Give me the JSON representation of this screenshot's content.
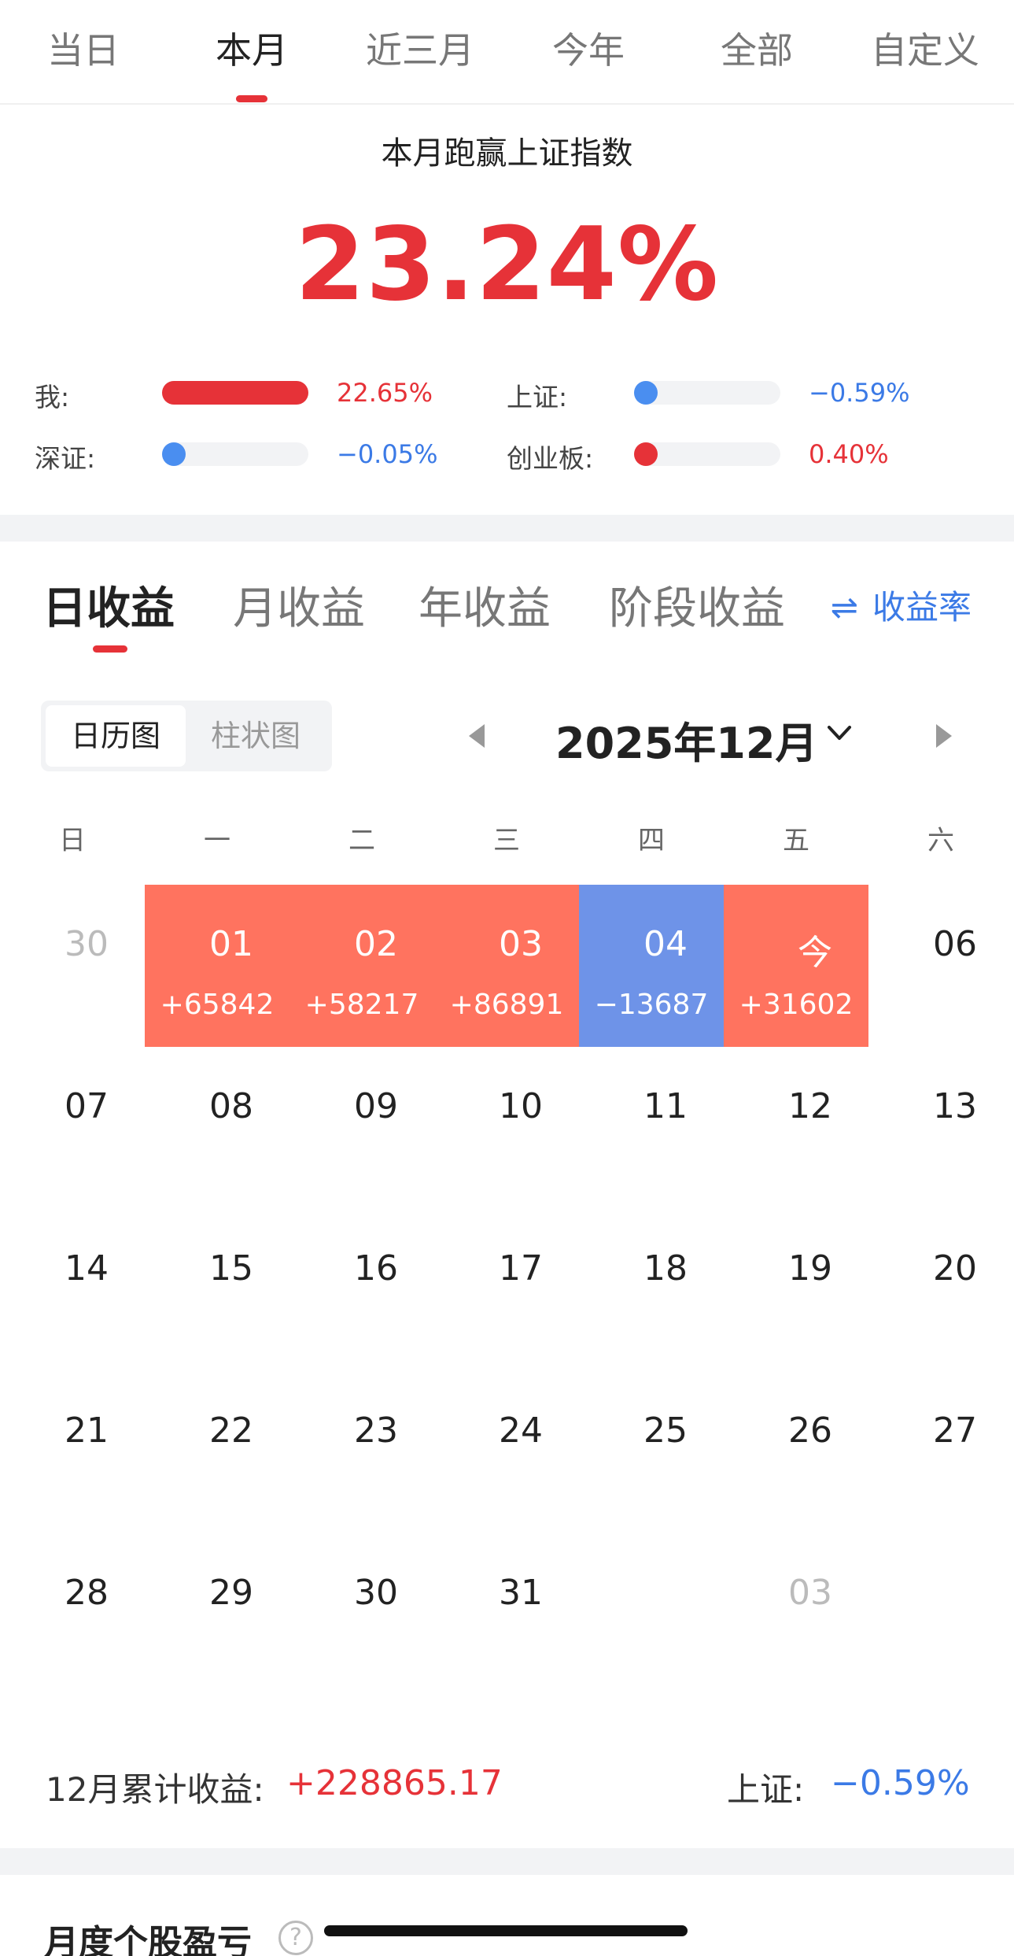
{
  "period_tabs": [
    {
      "label": "当日",
      "active": false
    },
    {
      "label": "本月",
      "active": true
    },
    {
      "label": "近三月",
      "active": false
    },
    {
      "label": "今年",
      "active": false
    },
    {
      "label": "全部",
      "active": false
    },
    {
      "label": "自定义",
      "active": false
    }
  ],
  "summary": {
    "title": "本月跑赢上证指数",
    "value": "23.24%",
    "comparisons": [
      {
        "label": "我:",
        "value": "22.65%",
        "fill": 1.0,
        "color": "red"
      },
      {
        "label": "上证:",
        "value": "−0.59%",
        "fill": 0.0,
        "color": "blue"
      },
      {
        "label": "深证:",
        "value": "−0.05%",
        "fill": 0.0,
        "color": "blue"
      },
      {
        "label": "创业板:",
        "value": "0.40%",
        "fill": 0.0,
        "color": "red"
      }
    ]
  },
  "income_tabs": [
    {
      "label": "日收益",
      "active": true
    },
    {
      "label": "月收益",
      "active": false
    },
    {
      "label": "年收益",
      "active": false
    },
    {
      "label": "阶段收益",
      "active": false
    }
  ],
  "rate_toggle": {
    "icon": "⇌",
    "label": "收益率"
  },
  "view_toggle": {
    "calendar": "日历图",
    "bar": "柱状图"
  },
  "month_picker": {
    "label": "2025年12月"
  },
  "weekdays": [
    "日",
    "一",
    "二",
    "三",
    "四",
    "五",
    "六"
  ],
  "calendar_weeks": [
    [
      {
        "day": "30",
        "muted": true
      },
      {
        "day": "01",
        "pnl": "+65842",
        "state": "gain"
      },
      {
        "day": "02",
        "pnl": "+58217",
        "state": "gain"
      },
      {
        "day": "03",
        "pnl": "+86891",
        "state": "gain"
      },
      {
        "day": "04",
        "pnl": "−13687",
        "state": "loss"
      },
      {
        "day": "今",
        "pnl": "+31602",
        "state": "gain"
      },
      {
        "day": "06"
      }
    ],
    [
      {
        "day": "07"
      },
      {
        "day": "08"
      },
      {
        "day": "09"
      },
      {
        "day": "10"
      },
      {
        "day": "11"
      },
      {
        "day": "12"
      },
      {
        "day": "13"
      }
    ],
    [
      {
        "day": "14"
      },
      {
        "day": "15"
      },
      {
        "day": "16"
      },
      {
        "day": "17"
      },
      {
        "day": "18"
      },
      {
        "day": "19"
      },
      {
        "day": "20"
      }
    ],
    [
      {
        "day": "21"
      },
      {
        "day": "22"
      },
      {
        "day": "23"
      },
      {
        "day": "24"
      },
      {
        "day": "25"
      },
      {
        "day": "26"
      },
      {
        "day": "27"
      }
    ],
    [
      {
        "day": "28"
      },
      {
        "day": "29"
      },
      {
        "day": "30"
      },
      {
        "day": "31"
      },
      {
        "day": ""
      },
      {
        "day": "03",
        "muted": true
      },
      {
        "day": ""
      }
    ]
  ],
  "totals": {
    "label": "12月累计收益:",
    "value": "+228865.17",
    "sh_label": "上证:",
    "sh_value": "−0.59%"
  },
  "section": {
    "title": "月度个股盈亏",
    "help": "?"
  },
  "colors": {
    "red": "#e63238",
    "blue": "#3b7ae6",
    "gain_cell": "#ff735f",
    "loss_cell": "#6e93e8"
  }
}
